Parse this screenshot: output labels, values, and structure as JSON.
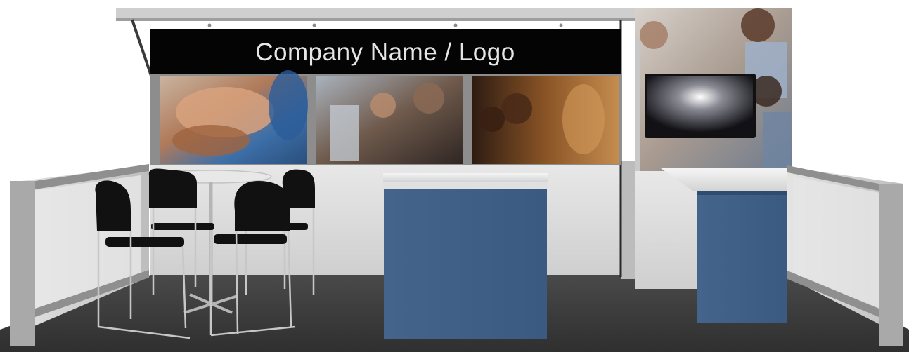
{
  "booth": {
    "header_text": "Company Name / Logo"
  },
  "colors": {
    "header_band": "#040404",
    "counter_blue": "#3f5f88",
    "carpet": "#3a3a3a",
    "wall": "#d9d9d9",
    "frame": "#9a9a9a"
  },
  "icons": {
    "chair": "chair-icon",
    "monitor": "monitor-icon"
  }
}
